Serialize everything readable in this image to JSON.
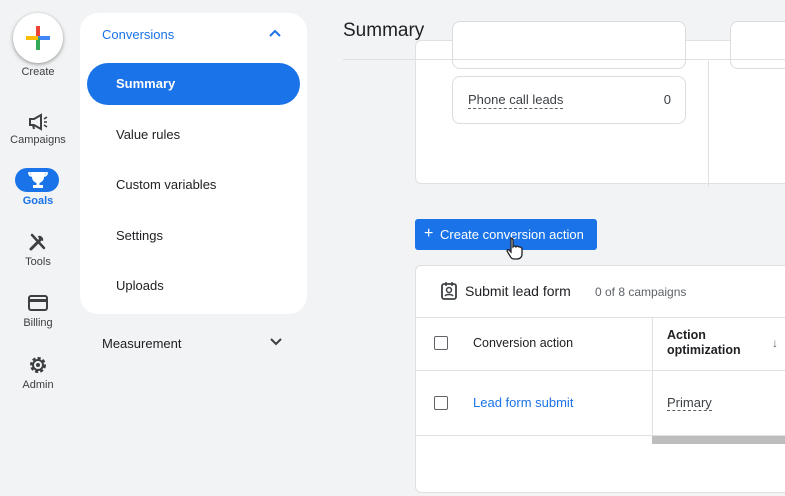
{
  "rail": {
    "create_label": "Create",
    "items": [
      {
        "label": "Campaigns",
        "icon": "megaphone-icon"
      },
      {
        "label": "Goals",
        "icon": "trophy-icon"
      },
      {
        "label": "Tools",
        "icon": "tools-icon"
      },
      {
        "label": "Billing",
        "icon": "credit-card-icon"
      },
      {
        "label": "Admin",
        "icon": "gear-icon"
      }
    ]
  },
  "subnav": {
    "header": "Conversions",
    "items": [
      "Summary",
      "Value rules",
      "Custom variables",
      "Settings",
      "Uploads"
    ],
    "selected": "Summary",
    "measurement": "Measurement"
  },
  "main": {
    "title": "Summary",
    "phone_leads": {
      "label": "Phone call leads",
      "value": "0"
    },
    "create_button": "Create conversion action",
    "card": {
      "title": "Submit lead form",
      "count": "0 of 8 campaigns",
      "col_action": "Conversion action",
      "col_optimization": "Action optimization",
      "rows": [
        {
          "action": "Lead form submit",
          "optimization": "Primary"
        }
      ]
    }
  },
  "colors": {
    "accent": "#1a73e8",
    "background": "#f1f3f4"
  }
}
